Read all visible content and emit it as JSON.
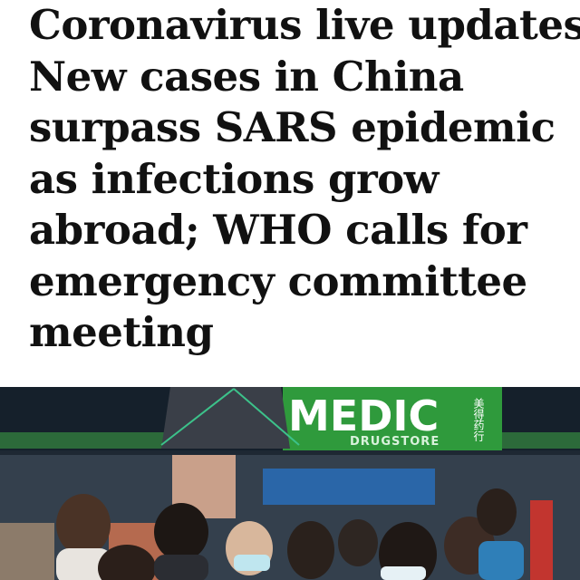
{
  "article": {
    "headline_lines": [
      "Coronavirus live updates:",
      "New cases in China",
      "surpass SARS epidemic",
      "as infections grow",
      "abroad; WHO calls for",
      "emergency committee",
      "meeting"
    ]
  },
  "photo": {
    "store_sign": "MEDIC",
    "store_subsign": "DRUGSTORE",
    "chinese_sign": "美得药行",
    "colors": {
      "sign_green": "#2f9a3c",
      "sign_text": "#ffffff",
      "storefront_dark": "#1c2530"
    }
  }
}
